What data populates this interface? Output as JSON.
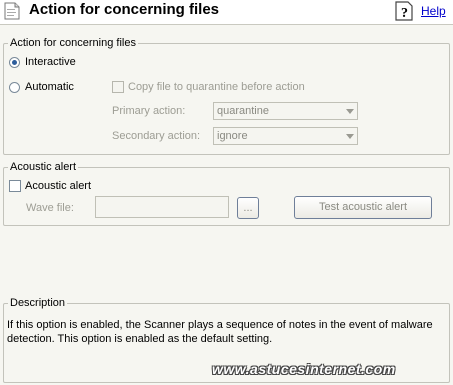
{
  "header": {
    "title": "Action for concerning files",
    "help_label": "Help"
  },
  "group_action": {
    "legend": "Action for concerning files",
    "interactive_label": "Interactive",
    "automatic_label": "Automatic",
    "copy_label": "Copy file to quarantine before action",
    "primary_label": "Primary action:",
    "primary_value": "quarantine",
    "secondary_label": "Secondary action:",
    "secondary_value": "ignore"
  },
  "group_alert": {
    "legend": "Acoustic alert",
    "checkbox_label": "Acoustic alert",
    "wave_label": "Wave file:",
    "browse_label": "...",
    "test_label": "Test acoustic alert"
  },
  "description": {
    "legend": "Description",
    "text": "If this option is enabled, the Scanner plays a sequence of notes in the event of malware detection. This option is enabled as the default setting."
  },
  "watermark": "www.astucesinternet.com"
}
